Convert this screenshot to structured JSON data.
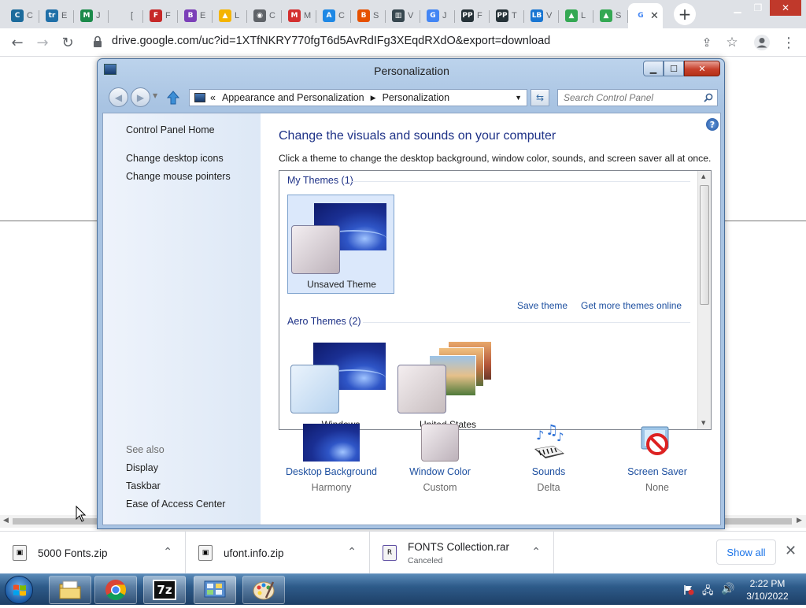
{
  "browser": {
    "active_tab_title": "G",
    "url": "drive.google.com/uc?id=1XTfNKRY770fgT6d5AvRdIFg3XEqdRXdO&export=download",
    "tabs": [
      {
        "icon": "C",
        "title": "C",
        "color": "#1c6b9c"
      },
      {
        "icon": "tr",
        "title": "E",
        "color": "#1f6fa8"
      },
      {
        "icon": "M",
        "title": "J",
        "color": "#1b8a4a"
      },
      {
        "icon": "",
        "title": "[",
        "color": "#dee1e6"
      },
      {
        "icon": "F",
        "title": "F",
        "color": "#c62828"
      },
      {
        "icon": "B",
        "title": "E",
        "color": "#7b3fb8"
      },
      {
        "icon": "▲",
        "title": "L",
        "color": "#f4b400"
      },
      {
        "icon": "◉",
        "title": "C",
        "color": "#5f6368"
      },
      {
        "icon": "M",
        "title": "M",
        "color": "#d32f2f"
      },
      {
        "icon": "A",
        "title": "C",
        "color": "#1e88e5"
      },
      {
        "icon": "B",
        "title": "S",
        "color": "#e65100"
      },
      {
        "icon": "▥",
        "title": "V",
        "color": "#37474f"
      },
      {
        "icon": "G",
        "title": "J",
        "color": "#4285f4"
      },
      {
        "icon": "PP",
        "title": "F",
        "color": "#263238"
      },
      {
        "icon": "PP",
        "title": "T",
        "color": "#263238"
      },
      {
        "icon": "LB",
        "title": "V",
        "color": "#1976d2"
      },
      {
        "icon": "▲",
        "title": "L",
        "color": "#34a853"
      },
      {
        "icon": "▲",
        "title": "S",
        "color": "#34a853"
      }
    ]
  },
  "window": {
    "title": "Personalization",
    "breadcrumb": [
      "«",
      "Appearance and Personalization",
      "Personalization"
    ],
    "search_placeholder": "Search Control Panel"
  },
  "left_pane": {
    "home": "Control Panel Home",
    "links": [
      "Change desktop icons",
      "Change mouse pointers"
    ],
    "see_also_label": "See also",
    "see_also": [
      "Display",
      "Taskbar",
      "Ease of Access Center"
    ]
  },
  "main": {
    "heading": "Change the visuals and sounds on your computer",
    "subheading": "Click a theme to change the desktop background, window color, sounds, and screen saver all at once.",
    "my_themes_label": "My Themes (1)",
    "my_themes": [
      {
        "name": "Unsaved Theme",
        "selected": true
      }
    ],
    "save_theme": "Save theme",
    "get_more": "Get more themes online",
    "aero_label": "Aero Themes (2)",
    "aero_themes": [
      "Windows",
      "United States"
    ]
  },
  "settings": [
    {
      "title": "Desktop Background",
      "value": "Harmony",
      "icon": "desktop-background-icon"
    },
    {
      "title": "Window Color",
      "value": "Custom",
      "icon": "window-color-icon"
    },
    {
      "title": "Sounds",
      "value": "Delta",
      "icon": "sounds-icon"
    },
    {
      "title": "Screen Saver",
      "value": "None",
      "icon": "screen-saver-icon"
    }
  ],
  "downloads": [
    {
      "name": "5000 Fonts.zip",
      "status": ""
    },
    {
      "name": "ufont.info.zip",
      "status": ""
    },
    {
      "name": "FONTS Collection.rar",
      "status": "Canceled"
    }
  ],
  "downloads_show_all": "Show all",
  "taskbar": {
    "time": "2:22 PM",
    "date": "3/10/2022",
    "pinned": [
      "explorer-icon",
      "chrome-icon",
      "7zip-icon",
      "control-panel-icon",
      "paint-icon"
    ]
  },
  "colors": {
    "link": "#1e50a0",
    "heading": "#1e3287",
    "chrome_blue": "#1a73e8"
  }
}
